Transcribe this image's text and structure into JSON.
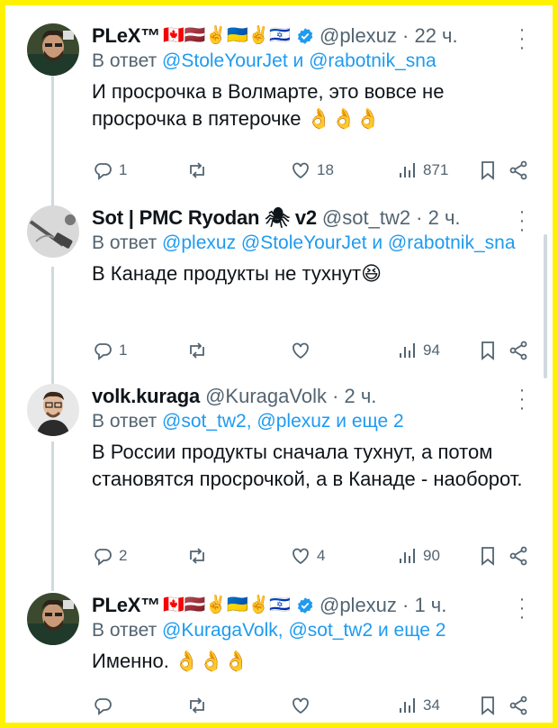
{
  "colors": {
    "border": "#fff200",
    "link": "#1d9bf0",
    "muted": "#536471",
    "verified": "#1d9bf0"
  },
  "tweets": [
    {
      "name": "PLeX™",
      "emojis": "🇨🇦🇱🇻✌️🇺🇦✌️🇮🇱",
      "handle": "@plexuz · 22 ч.",
      "reply_prefix": "В ответ ",
      "reply_mentions": "@StoleYourJet и @rabotnik_sna",
      "text": "И просрочка в Волмарте, это вовсе не просрочка в пятерочке 👌👌👌",
      "replies": "1",
      "retweets": "",
      "likes": "18",
      "views": "871"
    },
    {
      "name": "Sot | PMC Ryodan 🕷 v2",
      "emojis": "",
      "handle": "@sot_tw2 · 2 ч.",
      "reply_prefix": "В ответ ",
      "reply_mentions": "@plexuz @StoleYourJet и @rabotnik_sna",
      "text": "В Канаде продукты не тухнут😆",
      "replies": "1",
      "retweets": "",
      "likes": "",
      "views": "94"
    },
    {
      "name": "volk.kuraga",
      "emojis": "",
      "handle": "@KuragaVolk · 2 ч.",
      "reply_prefix": "В ответ ",
      "reply_mentions": "@sot_tw2, @plexuz и еще 2",
      "text": "В России продукты сначала тухнут, а потом становятся просрочкой, а в Канаде - наоборот.",
      "replies": "2",
      "retweets": "",
      "likes": "4",
      "views": "90"
    },
    {
      "name": "PLeX™",
      "emojis": "🇨🇦🇱🇻✌️🇺🇦✌️🇮🇱",
      "handle": "@plexuz · 1 ч.",
      "reply_prefix": "В ответ ",
      "reply_mentions": "@KuragaVolk, @sot_tw2 и еще 2",
      "text": "Именно. 👌👌👌",
      "replies": "",
      "retweets": "",
      "likes": "",
      "views": "34"
    }
  ],
  "icons": [
    "reply-icon",
    "retweet-icon",
    "like-icon",
    "views-icon",
    "bookmark-icon",
    "share-icon",
    "verified-icon",
    "more-icon"
  ]
}
